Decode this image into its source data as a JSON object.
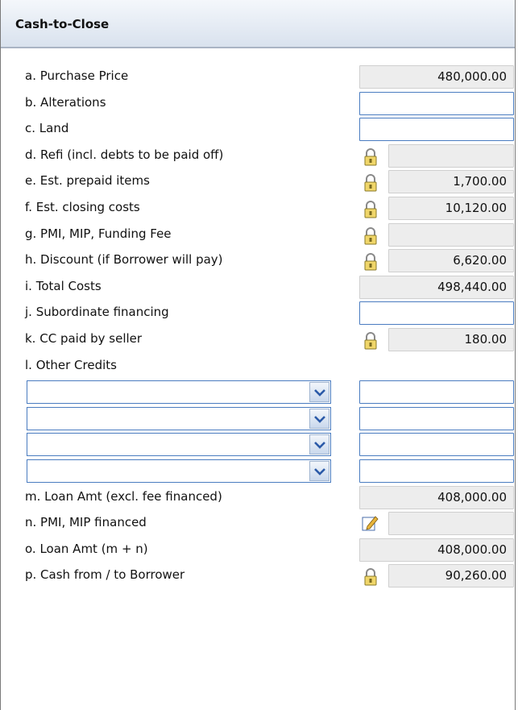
{
  "header": {
    "title": "Cash-to-Close"
  },
  "rows": [
    {
      "label": "a.  Purchase Price",
      "value": "480,000.00"
    },
    {
      "label": "b.  Alterations",
      "value": ""
    },
    {
      "label": "c.  Land",
      "value": ""
    },
    {
      "label": "d.  Refi (incl. debts to be paid off)",
      "value": ""
    },
    {
      "label": "e.  Est. prepaid items",
      "value": "1,700.00"
    },
    {
      "label": "f.  Est. closing costs",
      "value": "10,120.00"
    },
    {
      "label": "g.  PMI, MIP, Funding Fee",
      "value": ""
    },
    {
      "label": "h.  Discount (if Borrower will pay)",
      "value": "6,620.00"
    },
    {
      "label": "i.  Total Costs",
      "value": "498,440.00"
    },
    {
      "label": "j.  Subordinate financing",
      "value": ""
    },
    {
      "label": "k.  CC paid by seller",
      "value": "180.00"
    },
    {
      "label": "l.  Other Credits"
    },
    {
      "label": "m.  Loan Amt (excl. fee financed)",
      "value": "408,000.00"
    },
    {
      "label": "n.  PMI, MIP financed",
      "value": ""
    },
    {
      "label": "o.  Loan Amt (m + n)",
      "value": "408,000.00"
    },
    {
      "label": "p.  Cash from / to Borrower",
      "value": "90,260.00"
    }
  ],
  "other_credits": [
    {
      "type": "",
      "amount": ""
    },
    {
      "type": "",
      "amount": ""
    },
    {
      "type": "",
      "amount": ""
    },
    {
      "type": "",
      "amount": ""
    }
  ],
  "icons": {
    "lock": "padlock-icon",
    "edit": "edit-pencil-icon",
    "dropdown": "chevron-down-icon"
  },
  "colors": {
    "input_border": "#4a7cc0",
    "readonly_bg": "#ededed",
    "header_bg": "#d9e2ee"
  }
}
